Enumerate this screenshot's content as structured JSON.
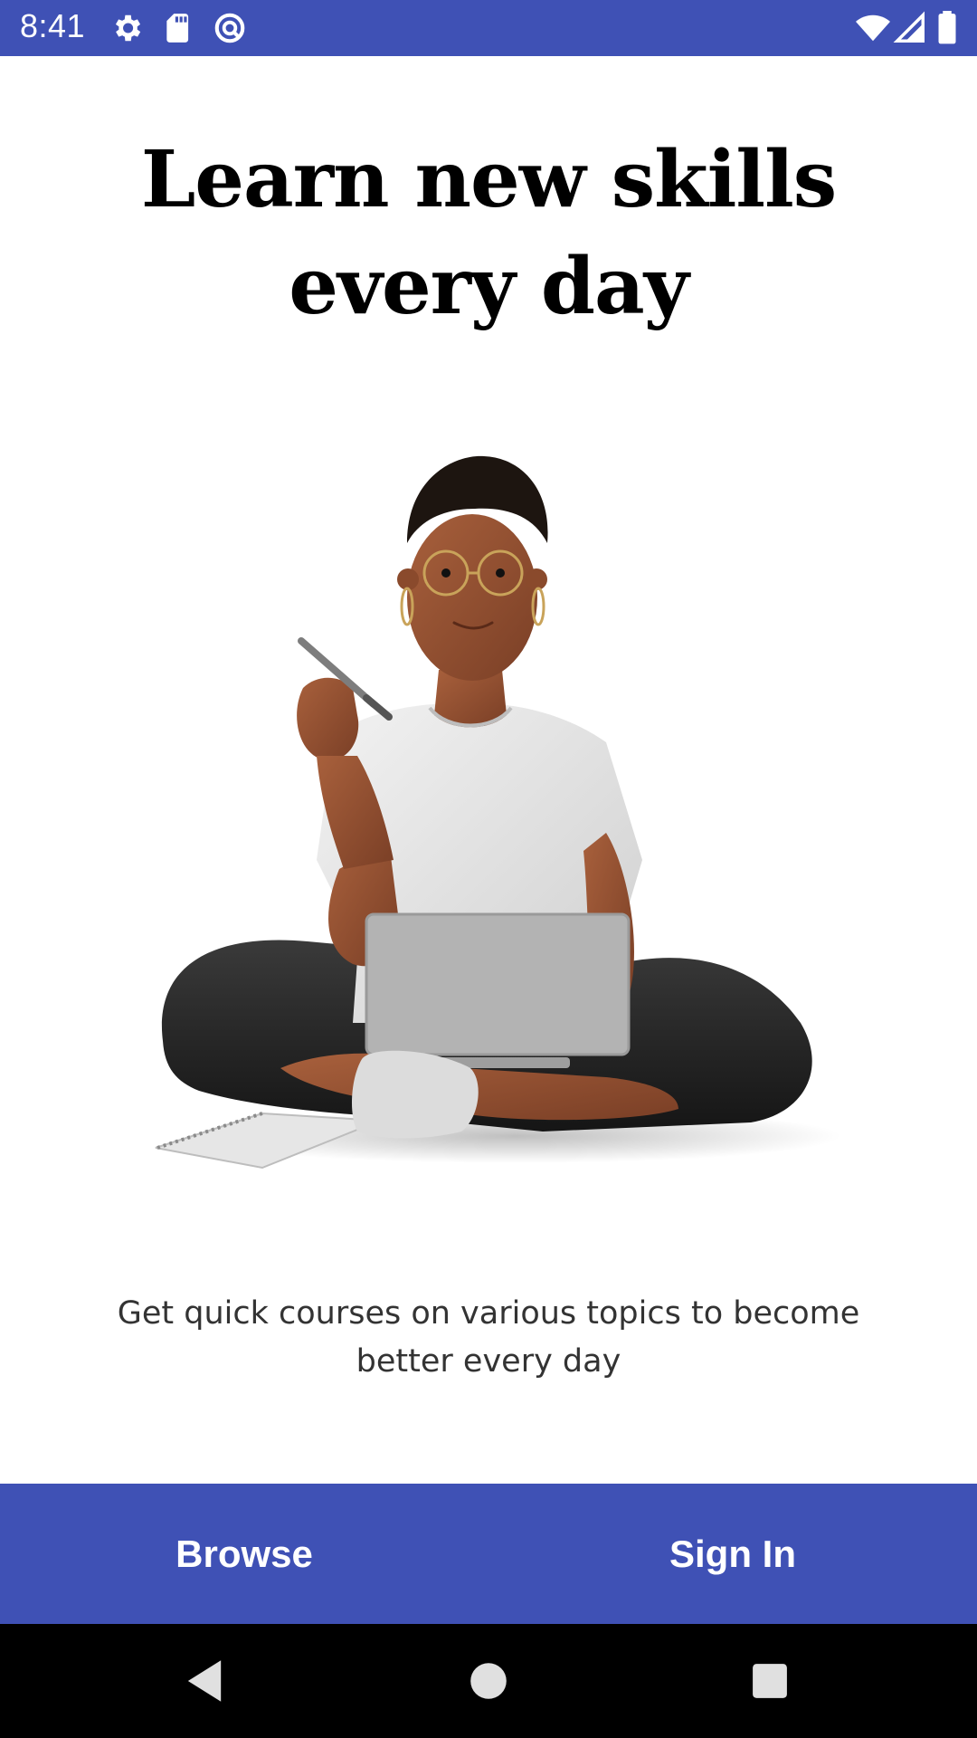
{
  "status_bar": {
    "time": "8:41",
    "left_icons": [
      "gear-icon",
      "sd-card-icon",
      "sync-icon"
    ],
    "right_icons": [
      "wifi-icon",
      "signal-icon",
      "battery-icon"
    ],
    "background": "#3f51b5"
  },
  "onboarding": {
    "headline_line1": "Learn new skills",
    "headline_line2": "every day",
    "subtitle": "Get quick courses on various topics to become better every day"
  },
  "actions": {
    "browse_label": "Browse",
    "signin_label": "Sign In",
    "background": "#3f51b5"
  },
  "nav_bar": {
    "icons": [
      "back-icon",
      "home-icon",
      "recents-icon"
    ]
  }
}
